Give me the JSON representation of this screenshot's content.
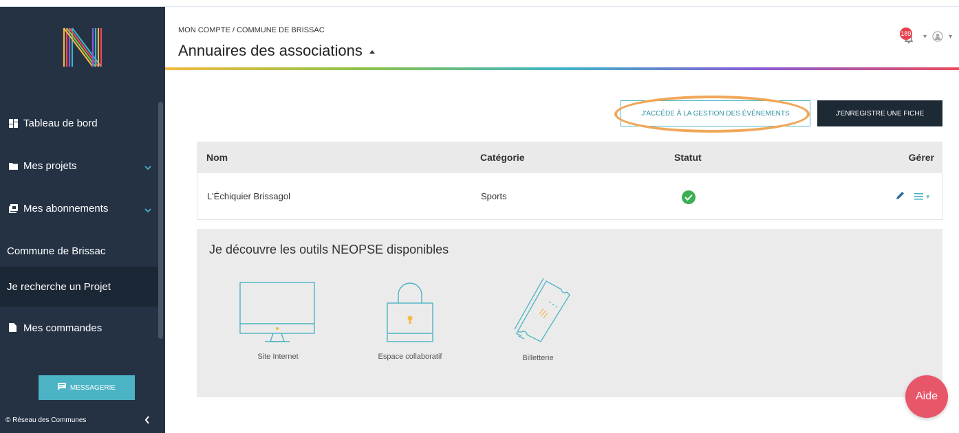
{
  "sidebar": {
    "items": [
      {
        "label": "Tableau de bord",
        "icon": "dashboard-icon"
      },
      {
        "label": "Mes projets",
        "icon": "folder-icon"
      },
      {
        "label": "Mes abonnements",
        "icon": "subscriptions-icon"
      },
      {
        "label": "Commune de Brissac"
      },
      {
        "label": "Je recherche un Projet"
      },
      {
        "label": "Mes commandes",
        "icon": "file-icon"
      }
    ],
    "messagerie_label": "MESSAGERIE",
    "footer": "© Réseau des Communes"
  },
  "header": {
    "breadcrumb": "MON COMPTE / COMMUNE DE BRISSAC",
    "title": "Annuaires des associations",
    "notification_count": "189"
  },
  "actions": {
    "events_label": "J'ACCÉDE À LA GESTION DES ÉVÉNEMENTS",
    "register_label": "J'ENREGISTRE UNE FICHE"
  },
  "table": {
    "headers": {
      "name": "Nom",
      "category": "Catégorie",
      "status": "Statut",
      "manage": "Gérer"
    },
    "rows": [
      {
        "name": "L'Échiquier Brissagol",
        "category": "Sports",
        "status": "active"
      }
    ]
  },
  "tools": {
    "title": "Je découvre les outils NEOPSE disponibles",
    "items": [
      {
        "label": "Site Internet",
        "icon": "monitor-icon"
      },
      {
        "label": "Espace collaboratif",
        "icon": "padlock-icon"
      },
      {
        "label": "Billetterie",
        "icon": "tickets-icon"
      }
    ]
  },
  "help_label": "Aide",
  "colors": {
    "sidebar": "#243244",
    "accent": "#4bb3c3",
    "highlight": "#f0a85a",
    "help": "#e8566a",
    "success": "#3cae53"
  }
}
